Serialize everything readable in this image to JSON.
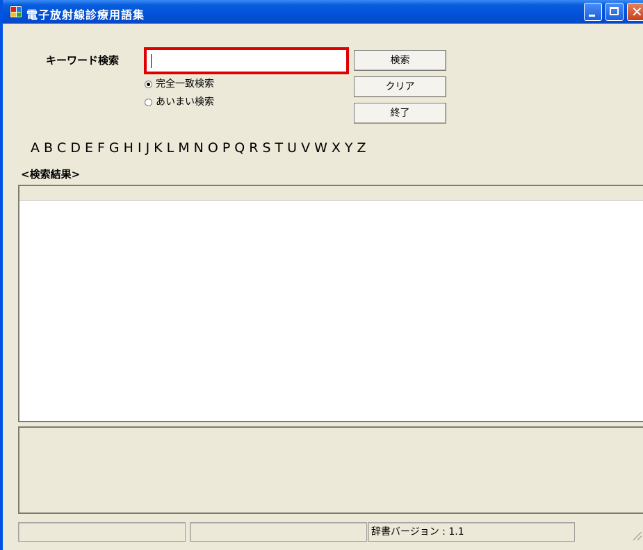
{
  "window": {
    "title": "電子放射線診療用語集"
  },
  "search": {
    "label": "キーワード検索",
    "value": "",
    "search_button": "検索",
    "clear_button": "クリア",
    "exit_button": "終了",
    "mode_options": [
      {
        "label": "完全一致検索",
        "selected": true
      },
      {
        "label": "あいまい検索",
        "selected": false
      }
    ]
  },
  "alphabet": [
    "A",
    "B",
    "C",
    "D",
    "E",
    "F",
    "G",
    "H",
    "I",
    "J",
    "K",
    "L",
    "M",
    "N",
    "O",
    "P",
    "Q",
    "R",
    "S",
    "T",
    "U",
    "V",
    "W",
    "X",
    "Y",
    "Z"
  ],
  "results": {
    "label": "<検索結果>"
  },
  "status": {
    "panel1": "",
    "panel2": "",
    "version": "辞書バージョン : 1.1"
  },
  "colors": {
    "highlight": "#e00000",
    "titlebar": "#0151d8",
    "face": "#ece9d8"
  }
}
